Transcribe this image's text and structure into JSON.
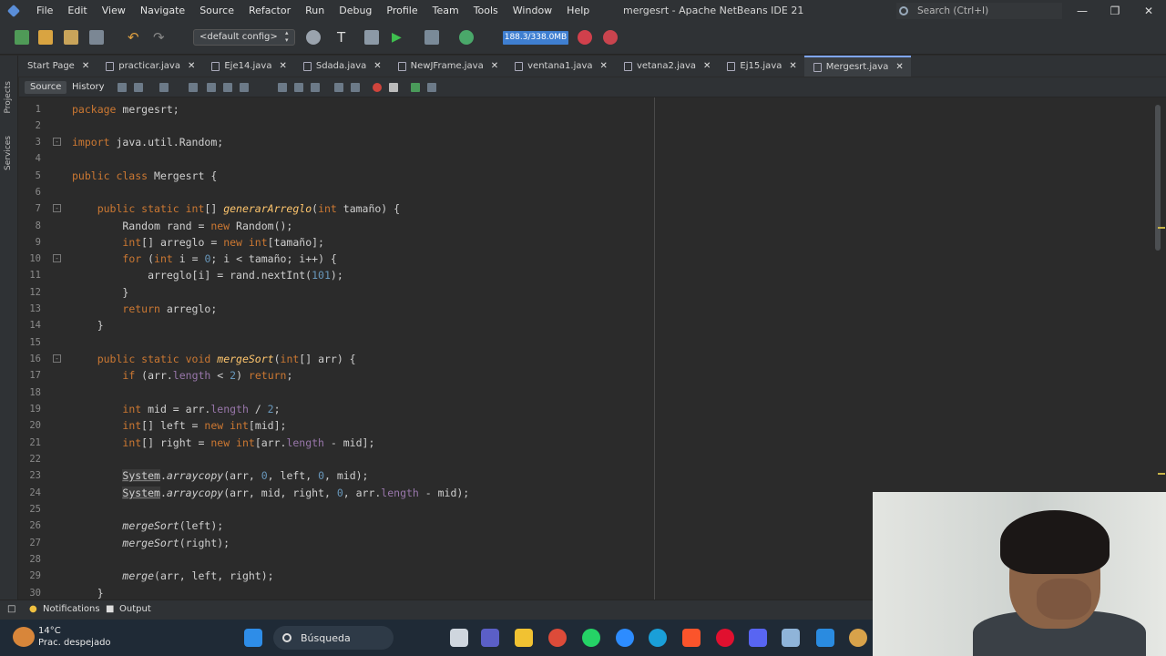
{
  "window": {
    "title": "mergesrt - Apache NetBeans IDE 21",
    "search_placeholder": "Search (Ctrl+I)",
    "minimize": "—",
    "maximize": "❐",
    "close": "✕"
  },
  "menu": [
    "File",
    "Edit",
    "View",
    "Navigate",
    "Source",
    "Refactor",
    "Run",
    "Debug",
    "Profile",
    "Team",
    "Tools",
    "Window",
    "Help"
  ],
  "toolbar": {
    "config": "<default config>",
    "memory": "188.3/338.0MB"
  },
  "tabs": [
    {
      "label": "Start Page",
      "active": false
    },
    {
      "label": "practicar.java",
      "active": false
    },
    {
      "label": "Eje14.java",
      "active": false
    },
    {
      "label": "Sdada.java",
      "active": false
    },
    {
      "label": "NewJFrame.java",
      "active": false
    },
    {
      "label": "ventana1.java",
      "active": false
    },
    {
      "label": "vetana2.java",
      "active": false
    },
    {
      "label": "Ej15.java",
      "active": false
    },
    {
      "label": "Mergesrt.java",
      "active": true
    }
  ],
  "side_panels": [
    "Projects",
    "Services"
  ],
  "editor_tabs": {
    "source": "Source",
    "history": "History"
  },
  "code": {
    "line_numbers": [
      "1",
      "2",
      "3",
      "4",
      "5",
      "6",
      "7",
      "8",
      "9",
      "10",
      "11",
      "12",
      "13",
      "14",
      "15",
      "16",
      "17",
      "18",
      "19",
      "20",
      "21",
      "22",
      "23",
      "24",
      "25",
      "26",
      "27",
      "28",
      "29",
      "30"
    ]
  },
  "status": {
    "notifications": "Notifications",
    "output": "Output"
  },
  "taskbar": {
    "temperature": "14°C",
    "weather": "Prac. despejado",
    "search": "Búsqueda"
  }
}
